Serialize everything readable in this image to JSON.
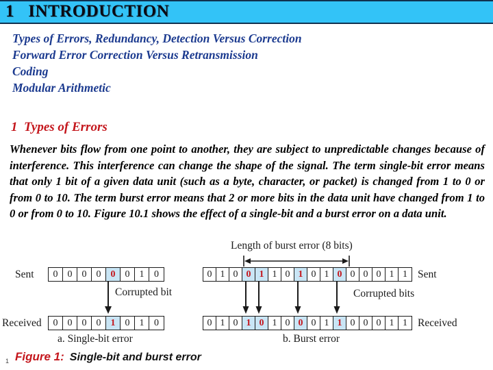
{
  "slide": {
    "title": "1   INTRODUCTION",
    "page_number": "1"
  },
  "topics": [
    {
      "label": "Types of Errors, Redundancy, Detection Versus Correction"
    },
    {
      "label": "Forward Error Correction Versus Retransmission"
    },
    {
      "label": "Coding"
    },
    {
      "label": "Modular Arithmetic"
    }
  ],
  "section": {
    "heading": "1  Types of Errors",
    "body": "Whenever bits flow from one point to another, they are subject to unpredictable changes because of interference. This interference can change the shape of the signal. The term single-bit error means that only 1 bit of a given data unit (such as a byte, character, or packet) is changed from 1 to 0 or from 0 to 10. The term burst error means that 2 or more bits in the data unit have changed from 1 to 0 or from 0 to 10. Figure 10.1 shows the effect of a single-bit and a burst error on a data unit."
  },
  "figure": {
    "caption_number": "Figure 1:",
    "caption_text": "Single-bit and burst error",
    "single_bit": {
      "sub_caption": "a. Single-bit error",
      "sent_label": "Sent",
      "received_label": "Received",
      "annotation": "Corrupted bit",
      "sent_bits": [
        "0",
        "0",
        "0",
        "0",
        "0",
        "0",
        "1",
        "0"
      ],
      "received_bits": [
        "0",
        "0",
        "0",
        "0",
        "1",
        "0",
        "1",
        "0"
      ],
      "corrupted_indices": [
        4
      ]
    },
    "burst": {
      "sub_caption": "b. Burst error",
      "sent_label": "Sent",
      "received_label": "Received",
      "annotation": "Corrupted bits",
      "length_label": "Length of burst error (8 bits)",
      "sent_bits": [
        "0",
        "1",
        "0",
        "0",
        "1",
        "1",
        "0",
        "1",
        "0",
        "1",
        "0",
        "0",
        "0",
        "0",
        "1",
        "1"
      ],
      "received_bits": [
        "0",
        "1",
        "0",
        "1",
        "0",
        "1",
        "0",
        "0",
        "0",
        "1",
        "1",
        "0",
        "0",
        "0",
        "1",
        "1"
      ],
      "corrupted_indices": [
        3,
        4,
        7,
        10
      ],
      "burst_span_start": 3,
      "burst_span_end": 10
    }
  },
  "colors": {
    "title_bar": "#33c3f7",
    "title_bar_border": "#10314f",
    "topic_text": "#1b3a8f",
    "heading_red": "#c4161c",
    "highlight_cell": "#c9e5f5"
  }
}
